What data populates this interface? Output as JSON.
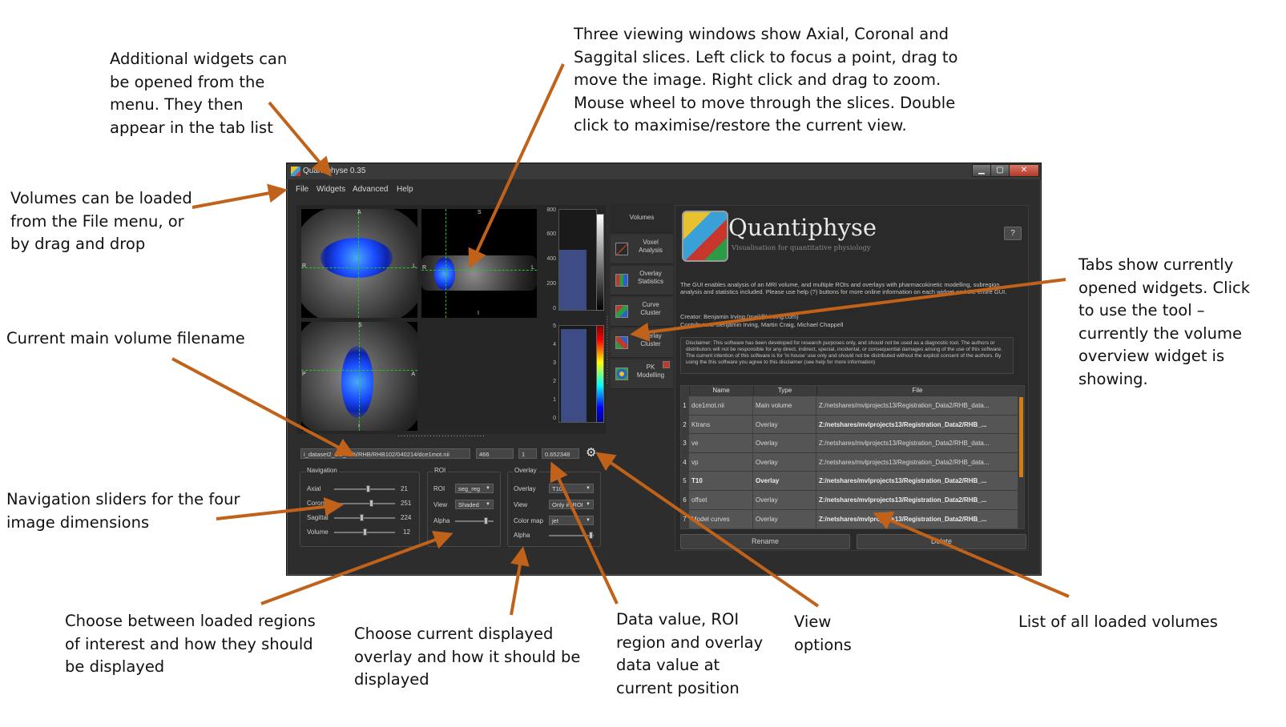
{
  "window": {
    "title": "Quantiphyse 0.35",
    "controls": {
      "minimize": "▁",
      "maximize": "▢",
      "close": "✕"
    },
    "menu": [
      "File",
      "Widgets",
      "Advanced",
      "Help"
    ]
  },
  "views": {
    "axial": {
      "labels": {
        "top": "A",
        "left": "R",
        "right": "L"
      }
    },
    "coronal": {
      "labels": {
        "top": "S",
        "bottom": "I",
        "left": "R",
        "right": "L"
      }
    },
    "sagittal": {
      "labels": {
        "top": "S",
        "bottom": "I",
        "left": "P",
        "right": "A"
      }
    }
  },
  "histograms": {
    "main": {
      "ticks": [
        "800",
        "600",
        "400",
        "200",
        "0"
      ]
    },
    "overlay": {
      "ticks": [
        "5",
        "4",
        "3",
        "2",
        "1",
        "0"
      ]
    }
  },
  "status": {
    "filename": "i_dataset2_BS_Nifti/RHB/RHB102/040214/dce1mot.nii",
    "data_value": "466",
    "roi_value": "1",
    "overlay_value": "0.652348",
    "view_options_icon": "gear-icon"
  },
  "navigation": {
    "title": "Navigation",
    "sliders": [
      {
        "label": "Axial",
        "value": "21",
        "position": 0.55
      },
      {
        "label": "Coronal",
        "value": "251",
        "position": 0.6
      },
      {
        "label": "Sagittal",
        "value": "224",
        "position": 0.45
      },
      {
        "label": "Volume",
        "value": "12",
        "position": 0.5
      }
    ]
  },
  "roi": {
    "title": "ROI",
    "roi_label": "ROI",
    "roi_value": "seg_reg",
    "view_label": "View",
    "view_value": "Shaded",
    "alpha_label": "Alpha",
    "alpha_position": 0.75
  },
  "overlay": {
    "title": "Overlay",
    "overlay_label": "Overlay",
    "overlay_value": "T10",
    "view_label": "View",
    "view_value": "Only in ROI",
    "colormap_label": "Color map",
    "colormap_value": "jet",
    "alpha_label": "Alpha",
    "alpha_position": 0.95
  },
  "tabs": [
    {
      "label": "Volumes",
      "icon": "volumes",
      "active": true
    },
    {
      "label": "Voxel\nAnalysis",
      "icon": "voxel-analysis-icon"
    },
    {
      "label": "Overlay\nStatistics",
      "icon": "overlay-statistics-icon"
    },
    {
      "label": "Curve\nCluster",
      "icon": "curve-cluster-icon"
    },
    {
      "label": "Overlay\nCluster",
      "icon": "overlay-cluster-icon"
    },
    {
      "label": "PK\nModelling",
      "icon": "pk-modelling-icon",
      "flag": true
    }
  ],
  "widget": {
    "logo_text": "Quantiphyse",
    "logo_sub": "Visualisation for quantitative physiology",
    "help_label": "?",
    "description": "The GUI enables analysis of an MRI volume, and multiple ROIs and overlays with pharmacokinetic modelling, subregion analysis and statistics included. Please use help (?) buttons for more online information on each widget and the entire GUI.",
    "creator": "Creator: Benjamin Irving (mail@birving.com)",
    "contributors": "Contributors: Benjamin Irving, Martin Craig, Michael Chappell",
    "disclaimer": "Disclaimer: This software has been developed for research purposes only, and should not be used as a diagnostic tool. The authors or distributors will not be responsible for any direct, indirect, special, incidental, or consequential damages arising of the use of this software. The current intention of this software is for 'in house' use only and should not be distributed without the explicit consent of the authors. By using the this software you agree to this disclaimer (see help for more information)",
    "table": {
      "headers": [
        "Name",
        "Type",
        "File"
      ],
      "rows": [
        {
          "num": "1",
          "name": "dce1mot.nii",
          "type": "Main volume",
          "file": "Z:/netshares/mvlprojects13/Registration_Data2/RHB_data...",
          "bold": false
        },
        {
          "num": "2",
          "name": "Ktrans",
          "type": "Overlay",
          "file": "Z:/netshares/mvlprojects13/Registration_Data2/RHB_...",
          "bold": false,
          "file_bold": true
        },
        {
          "num": "3",
          "name": "ve",
          "type": "Overlay",
          "file": "Z:/netshares/mvlprojects13/Registration_Data2/RHB_data...",
          "bold": false
        },
        {
          "num": "4",
          "name": "vp",
          "type": "Overlay",
          "file": "Z:/netshares/mvlprojects13/Registration_Data2/RHB_data...",
          "bold": false
        },
        {
          "num": "5",
          "name": "T10",
          "type": "Overlay",
          "file": "Z:/netshares/mvlprojects13/Registration_Data2/RHB_...",
          "bold": true,
          "file_bold": true
        },
        {
          "num": "6",
          "name": "offset",
          "type": "Overlay",
          "file": "Z:/netshares/mvlprojects13/Registration_Data2/RHB_...",
          "bold": false,
          "file_bold": true
        },
        {
          "num": "7",
          "name": "Model curves",
          "type": "Overlay",
          "file": "Z:/netshares/mvlprojects13/Registration_Data2/RHB_...",
          "bold": false,
          "file_bold": true
        }
      ]
    },
    "rename_label": "Rename",
    "delete_label": "Delete"
  },
  "annotations": {
    "widgets": "Additional widgets can\nbe opened from the\nmenu. They then\nappear in the tab list",
    "views": "Three viewing windows show Axial, Coronal and\nSaggital slices. Left click to focus a point, drag to\nmove the image. Right click and drag to zoom.\nMouse wheel to move through the slices. Double\nclick to maximise/restore the current view.",
    "volumes": "Volumes can be loaded\nfrom the File menu, or\nby drag and drop",
    "tabs": "Tabs show currently\nopened widgets. Click\nto use the tool –\ncurrently the volume\noverview widget is\nshowing.",
    "filename": "Current main volume filename",
    "navigation": "Navigation sliders for the four\nimage dimensions",
    "roi": "Choose between loaded regions\nof interest and how they should\nbe displayed",
    "overlay": "Choose current displayed\noverlay and how it should be\ndisplayed",
    "data_value": "Data value, ROI\nregion and overlay\ndata value at\ncurrent position",
    "view_options": "View\noptions",
    "volume_list": "List of all loaded volumes"
  },
  "colors": {
    "arrow": "#c0621a",
    "window_bg": "#2d2d2d",
    "table_thumb": "#d07c1a"
  }
}
